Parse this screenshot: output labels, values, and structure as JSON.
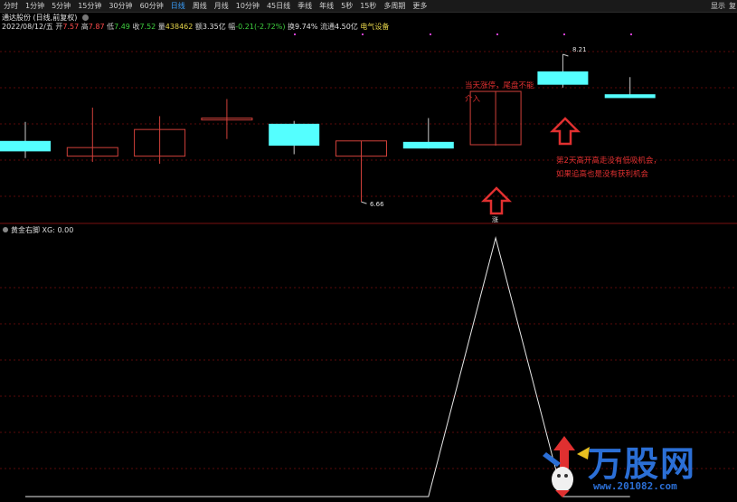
{
  "toolbar": {
    "tabs": [
      "分时",
      "1分钟",
      "5分钟",
      "15分钟",
      "30分钟",
      "60分钟",
      "日线",
      "周线",
      "月线",
      "10分钟",
      "45日线",
      "季线",
      "年线",
      "5秒",
      "15秒",
      "多周期",
      "更多"
    ],
    "active_tab": "日线",
    "right_display": "显示",
    "right_cut": "复"
  },
  "header": {
    "stock_title": "通达股份 (日线,前复权)"
  },
  "quote": {
    "date": "2022/08/12/五",
    "open_label": "开",
    "open": "7.57",
    "high_label": "高",
    "high": "7.87",
    "low_label": "低",
    "low": "7.49",
    "close_label": "收",
    "close": "7.52",
    "volume_label": "量",
    "volume": "438462",
    "amount_label": "额",
    "amount": "3.35亿",
    "change_label": "幅",
    "change": "-0.21(-2.72%)",
    "turnover_label": "换",
    "turnover": "9.74%",
    "float_label": "流通",
    "float": "4.50亿",
    "sector": "电气设备"
  },
  "main_chart": {
    "price_labels": {
      "low_marker": "6.66",
      "high_marker": "8.21"
    },
    "annotation_1": "当天涨停，尾盘不能介入",
    "annotation_2": "第2天高开高走没有低吸机会，如果追高也是没有获利机会",
    "limit_up_tag": "涨"
  },
  "indicator": {
    "name": "黄金右脚",
    "value_label": "XG: 0.00"
  },
  "watermark": {
    "brand": "万股网",
    "url": "www.201082.com"
  },
  "colors": {
    "up": "#ff4c4c",
    "down": "#54ffff",
    "grid": "#5a0a0a",
    "annotation": "#e03030",
    "indicator_line": "#e8e8e8"
  },
  "chart_data": [
    {
      "type": "candlestick",
      "title": "通达股份 (日线,前复权)",
      "candles": [
        {
          "open": 7.3,
          "high": 7.5,
          "low": 7.12,
          "close": 7.19,
          "direction": "down"
        },
        {
          "open": 7.14,
          "high": 7.65,
          "low": 7.08,
          "close": 7.23,
          "direction": "up"
        },
        {
          "open": 7.14,
          "high": 7.56,
          "low": 7.06,
          "close": 7.42,
          "direction": "up"
        },
        {
          "open": 7.52,
          "high": 7.74,
          "low": 7.32,
          "close": 7.54,
          "direction": "up"
        },
        {
          "open": 7.48,
          "high": 7.51,
          "low": 7.16,
          "close": 7.25,
          "direction": "down"
        },
        {
          "open": 7.14,
          "high": 7.3,
          "low": 6.66,
          "close": 7.3,
          "direction": "up"
        },
        {
          "open": 7.29,
          "high": 7.54,
          "low": 7.22,
          "close": 7.22,
          "direction": "down"
        },
        {
          "open": 7.26,
          "high": 7.82,
          "low": 7.25,
          "close": 7.82,
          "direction": "up",
          "tag": "涨"
        },
        {
          "open": 8.03,
          "high": 8.21,
          "low": 7.86,
          "close": 7.89,
          "direction": "down"
        },
        {
          "open": 7.79,
          "high": 7.97,
          "low": 7.75,
          "close": 7.75,
          "direction": "down"
        }
      ],
      "annotations": [
        "6.66",
        "8.21"
      ]
    },
    {
      "type": "line",
      "title": "黄金右脚",
      "series": [
        {
          "name": "XG",
          "values": [
            0,
            0,
            0,
            0,
            0,
            0,
            0,
            1,
            0,
            0
          ]
        }
      ],
      "ylim": [
        0,
        1
      ]
    }
  ]
}
